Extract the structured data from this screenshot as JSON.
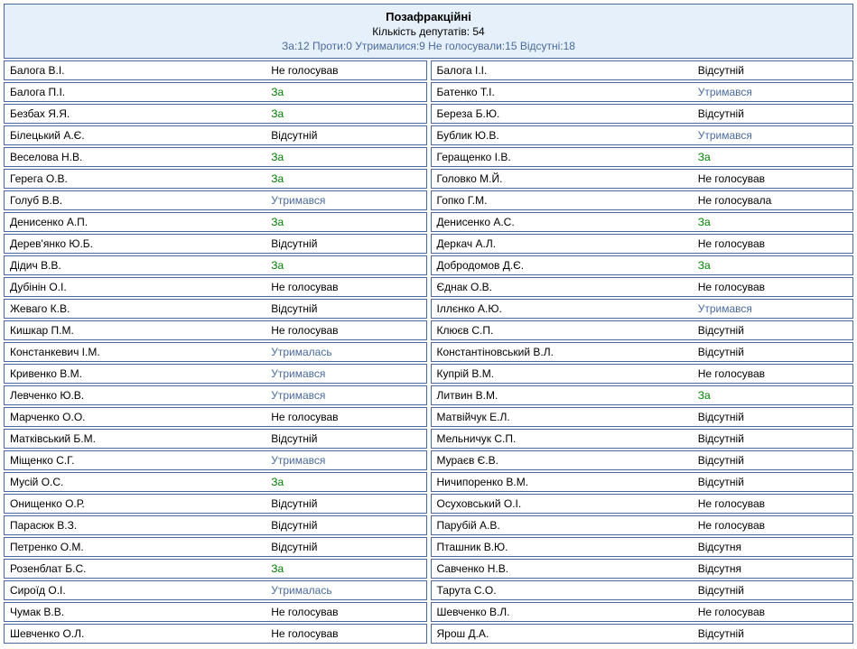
{
  "header": {
    "title": "Позафракційні",
    "count_label": "Кількість депутатів: 54",
    "stats": "За:12 Проти:0 Утрималися:9 Не голосували:15 Відсутні:18"
  },
  "vote_classes": {
    "За": "v-for",
    "Утримався": "v-abs",
    "Утрималась": "v-abs",
    "Відсутній": "v-none",
    "Відсутня": "v-none",
    "Не голосував": "v-none",
    "Не голосувала": "v-none"
  },
  "left": [
    {
      "name": "Балога В.І.",
      "vote": "Не голосував"
    },
    {
      "name": "Балога П.І.",
      "vote": "За"
    },
    {
      "name": "Безбах Я.Я.",
      "vote": "За"
    },
    {
      "name": "Білецький А.Є.",
      "vote": "Відсутній"
    },
    {
      "name": "Веселова Н.В.",
      "vote": "За"
    },
    {
      "name": "Герега О.В.",
      "vote": "За"
    },
    {
      "name": "Голуб В.В.",
      "vote": "Утримався"
    },
    {
      "name": "Денисенко А.П.",
      "vote": "За"
    },
    {
      "name": "Дерев'янко Ю.Б.",
      "vote": "Відсутній"
    },
    {
      "name": "Дідич В.В.",
      "vote": "За"
    },
    {
      "name": "Дубінін О.І.",
      "vote": "Не голосував"
    },
    {
      "name": "Жеваго К.В.",
      "vote": "Відсутній"
    },
    {
      "name": "Кишкар П.М.",
      "vote": "Не голосував"
    },
    {
      "name": "Констанкевич І.М.",
      "vote": "Утрималась"
    },
    {
      "name": "Кривенко В.М.",
      "vote": "Утримався"
    },
    {
      "name": "Левченко Ю.В.",
      "vote": "Утримався"
    },
    {
      "name": "Марченко О.О.",
      "vote": "Не голосував"
    },
    {
      "name": "Матківський Б.М.",
      "vote": "Відсутній"
    },
    {
      "name": "Міщенко С.Г.",
      "vote": "Утримався"
    },
    {
      "name": "Мусій О.С.",
      "vote": "За"
    },
    {
      "name": "Онищенко О.Р.",
      "vote": "Відсутній"
    },
    {
      "name": "Парасюк В.З.",
      "vote": "Відсутній"
    },
    {
      "name": "Петренко О.М.",
      "vote": "Відсутній"
    },
    {
      "name": "Розенблат Б.С.",
      "vote": "За"
    },
    {
      "name": "Сироїд О.І.",
      "vote": "Утрималась"
    },
    {
      "name": "Чумак В.В.",
      "vote": "Не голосував"
    },
    {
      "name": "Шевченко О.Л.",
      "vote": "Не голосував"
    }
  ],
  "right": [
    {
      "name": "Балога І.І.",
      "vote": "Відсутній"
    },
    {
      "name": "Батенко Т.І.",
      "vote": "Утримався"
    },
    {
      "name": "Береза Б.Ю.",
      "vote": "Відсутній"
    },
    {
      "name": "Бублик Ю.В.",
      "vote": "Утримався"
    },
    {
      "name": "Геращенко І.В.",
      "vote": "За"
    },
    {
      "name": "Головко М.Й.",
      "vote": "Не голосував"
    },
    {
      "name": "Гопко Г.М.",
      "vote": "Не голосувала"
    },
    {
      "name": "Денисенко А.С.",
      "vote": "За"
    },
    {
      "name": "Деркач А.Л.",
      "vote": "Не голосував"
    },
    {
      "name": "Добродомов Д.Є.",
      "vote": "За"
    },
    {
      "name": "Єднак О.В.",
      "vote": "Не голосував"
    },
    {
      "name": "Іллєнко А.Ю.",
      "vote": "Утримався"
    },
    {
      "name": "Клюєв С.П.",
      "vote": "Відсутній"
    },
    {
      "name": "Константіновський В.Л.",
      "vote": "Відсутній"
    },
    {
      "name": "Купрій В.М.",
      "vote": "Не голосував"
    },
    {
      "name": "Литвин В.М.",
      "vote": "За"
    },
    {
      "name": "Матвійчук Е.Л.",
      "vote": "Відсутній"
    },
    {
      "name": "Мельничук С.П.",
      "vote": "Відсутній"
    },
    {
      "name": "Мураєв Є.В.",
      "vote": "Відсутній"
    },
    {
      "name": "Ничипоренко В.М.",
      "vote": "Відсутній"
    },
    {
      "name": "Осуховський О.І.",
      "vote": "Не голосував"
    },
    {
      "name": "Парубій А.В.",
      "vote": "Не голосував"
    },
    {
      "name": "Пташник В.Ю.",
      "vote": "Відсутня"
    },
    {
      "name": "Савченко Н.В.",
      "vote": "Відсутня"
    },
    {
      "name": "Тарута С.О.",
      "vote": "Відсутній"
    },
    {
      "name": "Шевченко В.Л.",
      "vote": "Не голосував"
    },
    {
      "name": "Ярош Д.А.",
      "vote": "Відсутній"
    }
  ]
}
